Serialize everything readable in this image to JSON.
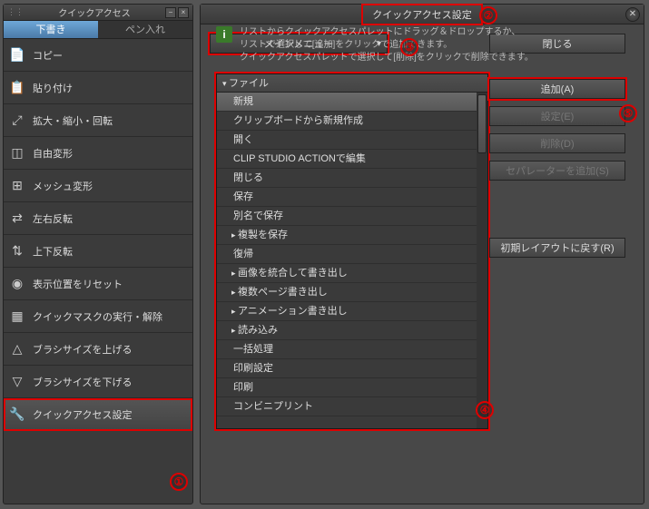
{
  "leftPanel": {
    "title": "クイックアクセス",
    "tabs": {
      "active": "下書き",
      "inactive": "ペン入れ"
    },
    "items": [
      {
        "icon": "📄",
        "label": "コピー"
      },
      {
        "icon": "📋",
        "label": "貼り付け"
      },
      {
        "icon": "⤢",
        "label": "拡大・縮小・回転"
      },
      {
        "icon": "◫",
        "label": "自由変形"
      },
      {
        "icon": "⊞",
        "label": "メッシュ変形"
      },
      {
        "icon": "⇄",
        "label": "左右反転"
      },
      {
        "icon": "⇅",
        "label": "上下反転"
      },
      {
        "icon": "◉",
        "label": "表示位置をリセット"
      },
      {
        "icon": "▦",
        "label": "クイックマスクの実行・解除"
      },
      {
        "icon": "△",
        "label": "ブラシサイズを上げる"
      },
      {
        "icon": "▽",
        "label": "ブラシサイズを下げる"
      },
      {
        "icon": "🔧",
        "label": "クイックアクセス設定"
      }
    ]
  },
  "dialog": {
    "title": "クイックアクセス設定",
    "dropdown": "メインメニュー",
    "closeBtn": "閉じる",
    "buttons": {
      "add": "追加(A)",
      "settei": "設定(E)",
      "delete": "削除(D)",
      "separator": "セパレーターを追加(S)",
      "reset": "初期レイアウトに戻す(R)"
    },
    "tree": {
      "header": "ファイル",
      "items": [
        {
          "label": "新規",
          "selected": true
        },
        {
          "label": "クリップボードから新規作成"
        },
        {
          "label": "開く"
        },
        {
          "label": "CLIP STUDIO ACTIONで編集"
        },
        {
          "label": "閉じる"
        },
        {
          "label": "保存"
        },
        {
          "label": "別名で保存"
        },
        {
          "label": "複製を保存",
          "arrow": true
        },
        {
          "label": "復帰"
        },
        {
          "label": "画像を統合して書き出し",
          "arrow": true
        },
        {
          "label": "複数ページ書き出し",
          "arrow": true
        },
        {
          "label": "アニメーション書き出し",
          "arrow": true
        },
        {
          "label": "読み込み",
          "arrow": true
        },
        {
          "label": "一括処理"
        },
        {
          "label": "印刷設定"
        },
        {
          "label": "印刷"
        },
        {
          "label": "コンビニプリント"
        }
      ]
    },
    "hint": {
      "line1": "リストからクイックアクセスパレットにドラッグ＆ドロップするか、",
      "line2": "リストで選択して[追加]をクリックで追加できます。",
      "line3": "クイックアクセスパレットで選択して[削除]をクリックで削除できます。"
    }
  },
  "annotations": {
    "n1": "①",
    "n2": "②",
    "n3": "③",
    "n4": "④",
    "n5": "⑤"
  }
}
